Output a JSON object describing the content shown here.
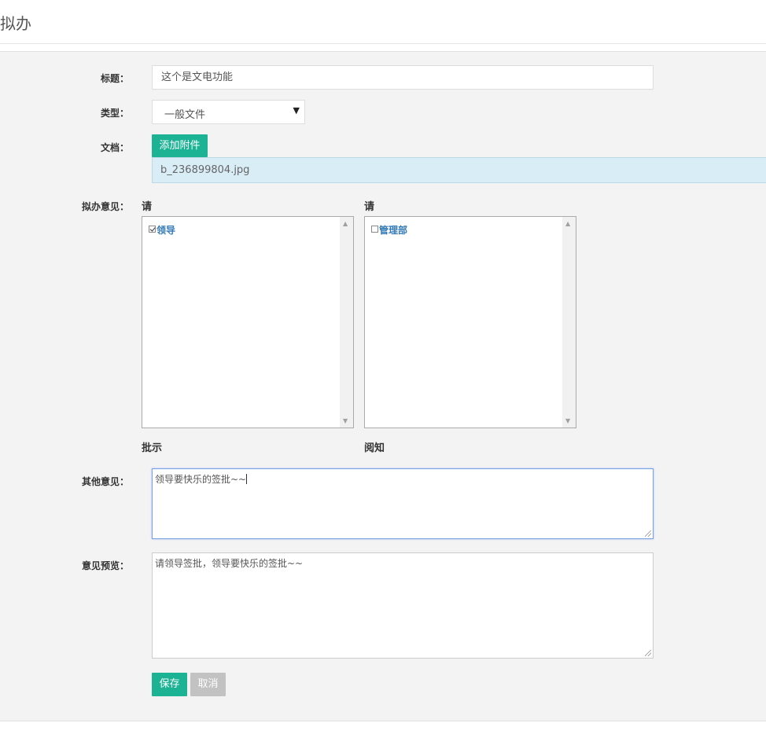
{
  "header": {
    "title": "拟办"
  },
  "form": {
    "title_label": "标题：",
    "title_value": "这个是文电功能",
    "type_label": "类型：",
    "type_value": "一般文件",
    "doc_label": "文档：",
    "add_attachment": "添加附件",
    "attachment_name": "b_236899804.jpg",
    "opinion_label": "拟办意见：",
    "left_column": {
      "heading": "请",
      "items": [
        {
          "label": "领导",
          "checked": true
        }
      ],
      "footer": "批示"
    },
    "right_column": {
      "heading": "请",
      "items": [
        {
          "label": "管理部",
          "checked": false
        }
      ],
      "footer": "阅知"
    },
    "other_label": "其他意见：",
    "other_value": "领导要快乐的签批~~",
    "preview_label": "意见预览：",
    "preview_value": "请领导签批，领导要快乐的签批~~",
    "save": "保存",
    "cancel": "取消"
  },
  "icons": {
    "select_arrow": "triangle-down-icon",
    "scroll_up": "triangle-up-icon",
    "scroll_down": "triangle-down-icon"
  },
  "colors": {
    "primary": "#1bb394",
    "disabled": "#c2c2c2",
    "link": "#337ab7",
    "attachment_bg": "#d9edf7"
  }
}
